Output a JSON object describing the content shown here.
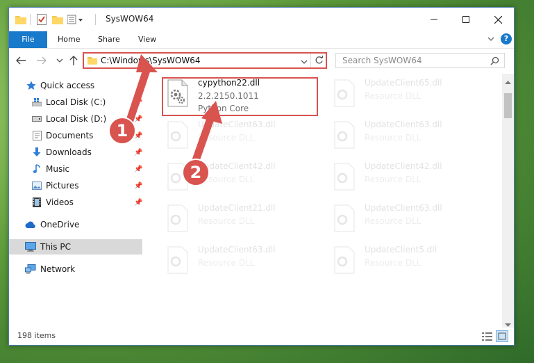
{
  "window": {
    "title": "SysWOW64"
  },
  "ribbon": {
    "tabs": [
      "File",
      "Home",
      "Share",
      "View"
    ]
  },
  "address": {
    "path": "C:\\Windows\\SysWOW64"
  },
  "search": {
    "placeholder": "Search SysWOW64"
  },
  "nav": {
    "quick_access": "Quick access",
    "local_c": "Local Disk (C:)",
    "local_d": "Local Disk (D:)",
    "documents": "Documents",
    "downloads": "Downloads",
    "music": "Music",
    "pictures": "Pictures",
    "videos": "Videos",
    "onedrive": "OneDrive",
    "this_pc": "This PC",
    "network": "Network"
  },
  "files": {
    "selected": {
      "name": "cypython22.dll",
      "version": "2.2.2150.1011",
      "desc": "Python Core"
    },
    "items": [
      {
        "name": "UpdateClient65.dll",
        "desc": "Resource DLL"
      },
      {
        "name": "UpdateClient63.dll",
        "desc": "Resource DLL"
      },
      {
        "name": "UpdateClient63.dll",
        "desc": "Resource DLL"
      },
      {
        "name": "UpdateClient42.dll",
        "desc": "Resource DLL"
      },
      {
        "name": "UpdateClient42.dll",
        "desc": "Resource DLL"
      },
      {
        "name": "UpdateClient21.dll",
        "desc": "Resource DLL"
      },
      {
        "name": "UpdateClient63.dll",
        "desc": "Resource DLL"
      },
      {
        "name": "UpdateClient63.dll",
        "desc": "Resource DLL"
      },
      {
        "name": "UpdateClient5.dll",
        "desc": "Resource DLL"
      }
    ]
  },
  "status": {
    "count": "198 items"
  },
  "annotations": {
    "step1": "1",
    "step2": "2"
  },
  "colors": {
    "accent": "#1979ca",
    "annotation": "#d9534f"
  }
}
